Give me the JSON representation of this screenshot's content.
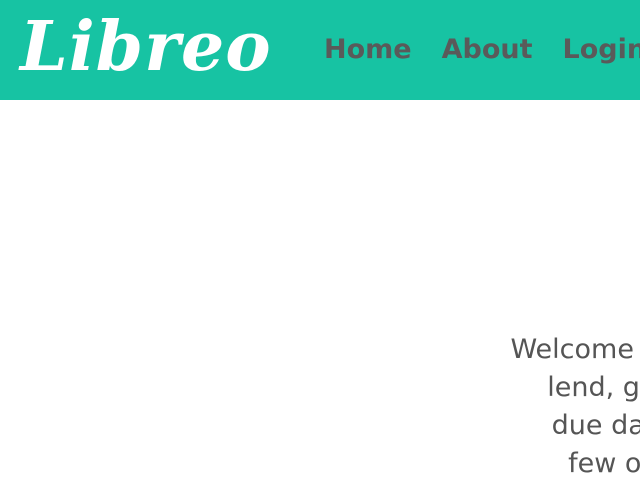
{
  "header": {
    "logo": "Libreo",
    "nav": {
      "home": "Home",
      "about": "About",
      "login": "Login"
    }
  },
  "main": {
    "welcome_lines": [
      "Welcome to Libreo",
      "lend, give, or",
      "due dates, n",
      "few of the"
    ]
  },
  "colors": {
    "header_bg": "#17c3a3",
    "nav_text": "#5a5a5a",
    "body_text": "#555555",
    "logo_text": "#ffffff"
  }
}
